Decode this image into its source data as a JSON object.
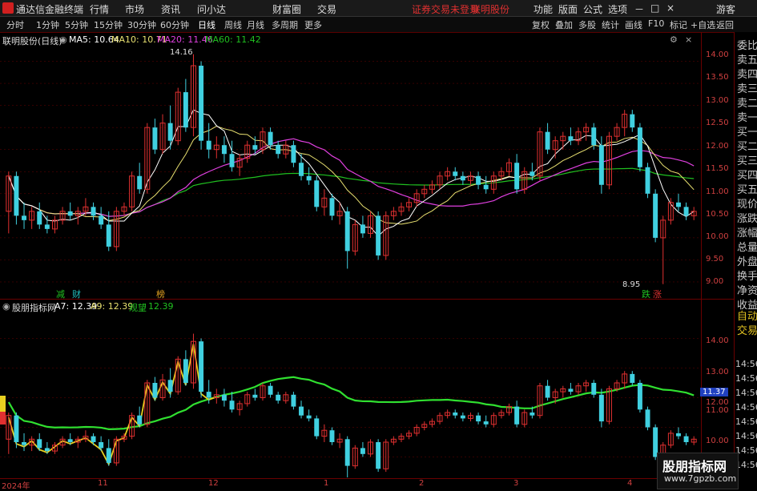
{
  "app": {
    "title": "通达信金融终端",
    "menu": [
      "行情",
      "市场",
      "资讯",
      "问小达",
      "财富圈",
      "交易"
    ],
    "notice": "证券交易未登录",
    "stock_tab": "联明股份",
    "right_menu": [
      "功能",
      "版面",
      "公式",
      "选项"
    ],
    "guest": "游客",
    "window_controls": [
      "－",
      "□",
      "×"
    ]
  },
  "toolbar": {
    "timeframes": [
      "分时",
      "1分钟",
      "5分钟",
      "15分钟",
      "30分钟",
      "60分钟",
      "日线",
      "周线",
      "月线",
      "多周期",
      "更多"
    ],
    "active": "日线",
    "right_buttons": [
      "复权",
      "叠加",
      "多股",
      "统计",
      "画线",
      "F10",
      "标记",
      "+自选",
      "返回"
    ]
  },
  "main_panel": {
    "stock_title": "联明股份(日线)",
    "ma": [
      {
        "label": "MA5: 10.64",
        "color": "#ffffff"
      },
      {
        "label": "MA10: 10.71",
        "color": "#e8e070"
      },
      {
        "label": "MA20: 11.46",
        "color": "#e040e0"
      },
      {
        "label": "MA60: 11.42",
        "color": "#20c020"
      }
    ],
    "high_label": "14.16",
    "low_label": "8.95",
    "y_ticks": [
      "14.00",
      "13.50",
      "13.00",
      "12.50",
      "12.00",
      "11.50",
      "11.00",
      "10.50",
      "10.00",
      "9.50",
      "9.00"
    ],
    "markers": [
      {
        "text": "减",
        "color": "#20c020"
      },
      {
        "text": "财",
        "color": "#20c0c0"
      },
      {
        "text": "榜",
        "color": "#e0a020"
      },
      {
        "text": "跌",
        "color": "#20c020"
      },
      {
        "text": "涨",
        "color": "#e03030"
      }
    ]
  },
  "sub_panel": {
    "indicator_name": "股朋指标网",
    "params": [
      {
        "label": "A7: 12.39",
        "color": "#ffffff"
      },
      {
        "label": "A9: 12.39",
        "color": "#e8e070"
      },
      {
        "label": "观望",
        "color": "#20c020"
      },
      {
        "label": "12.39",
        "color": "#20c020"
      }
    ],
    "y_ticks": [
      "14.00",
      "13.00",
      "12.00",
      "11.00",
      "10.00"
    ],
    "current_price": "11.37"
  },
  "x_axis": [
    "2024年",
    "11",
    "12",
    "1",
    "2",
    "3",
    "4"
  ],
  "right_panel": {
    "labels": [
      "委比",
      "卖五",
      "卖四",
      "卖三",
      "卖二",
      "卖一",
      "买一",
      "买二",
      "买三",
      "买四",
      "买五",
      "现价",
      "涨跌",
      "涨幅",
      "总量",
      "外盘",
      "换手",
      "净资",
      "收益"
    ],
    "lower_labels": [
      "自动",
      "交易"
    ],
    "times": [
      "14:56",
      "14:56",
      "14:56",
      "14:56",
      "14:56",
      "14:56",
      "14:56",
      "14:56"
    ]
  },
  "watermark": {
    "title": "股朋指标网",
    "url": "www.7gpzb.com"
  },
  "colors": {
    "up": "#e03030",
    "down": "#40d0e0",
    "axis": "#d04040",
    "grid": "#6a0000"
  },
  "chart_data": {
    "type": "candlestick",
    "ylim": [
      8.8,
      14.3
    ],
    "candles": [
      [
        10.6,
        11.5,
        10.1,
        11.4
      ],
      [
        11.4,
        11.5,
        10.3,
        10.5
      ],
      [
        10.5,
        10.8,
        10.2,
        10.4
      ],
      [
        10.4,
        10.7,
        10.2,
        10.6
      ],
      [
        10.6,
        10.8,
        10.2,
        10.3
      ],
      [
        10.3,
        10.5,
        10.1,
        10.2
      ],
      [
        10.2,
        10.5,
        10.1,
        10.4
      ],
      [
        10.4,
        10.7,
        10.3,
        10.6
      ],
      [
        10.6,
        10.8,
        10.4,
        10.5
      ],
      [
        10.5,
        10.7,
        10.3,
        10.6
      ],
      [
        10.6,
        10.9,
        10.5,
        10.7
      ],
      [
        10.7,
        10.8,
        10.4,
        10.5
      ],
      [
        10.5,
        10.7,
        10.2,
        10.3
      ],
      [
        10.3,
        10.6,
        9.7,
        9.8
      ],
      [
        9.8,
        10.7,
        9.7,
        10.6
      ],
      [
        10.6,
        10.8,
        10.5,
        10.7
      ],
      [
        10.7,
        11.5,
        10.6,
        11.4
      ],
      [
        11.4,
        11.7,
        11.0,
        11.1
      ],
      [
        11.1,
        12.6,
        11.0,
        12.5
      ],
      [
        12.5,
        12.7,
        11.9,
        12.0
      ],
      [
        12.0,
        12.8,
        11.9,
        12.6
      ],
      [
        12.6,
        13.0,
        12.0,
        12.2
      ],
      [
        12.2,
        13.4,
        12.1,
        13.3
      ],
      [
        13.3,
        13.6,
        12.4,
        12.5
      ],
      [
        12.5,
        14.16,
        12.3,
        13.9
      ],
      [
        13.9,
        14.0,
        12.0,
        12.2
      ],
      [
        12.2,
        12.6,
        11.8,
        12.0
      ],
      [
        12.0,
        12.3,
        11.8,
        12.1
      ],
      [
        12.1,
        12.3,
        11.7,
        11.9
      ],
      [
        11.9,
        12.2,
        11.5,
        11.6
      ],
      [
        11.6,
        11.9,
        11.4,
        11.8
      ],
      [
        11.8,
        12.2,
        11.7,
        12.1
      ],
      [
        12.1,
        12.3,
        11.9,
        12.0
      ],
      [
        12.0,
        12.5,
        11.9,
        12.4
      ],
      [
        12.4,
        12.5,
        12.0,
        12.1
      ],
      [
        12.1,
        12.2,
        11.8,
        11.9
      ],
      [
        11.9,
        12.2,
        11.8,
        12.1
      ],
      [
        12.1,
        12.2,
        11.6,
        11.7
      ],
      [
        11.7,
        11.9,
        11.3,
        11.4
      ],
      [
        11.4,
        11.6,
        11.2,
        11.3
      ],
      [
        11.3,
        11.4,
        10.6,
        10.7
      ],
      [
        10.7,
        11.1,
        10.5,
        10.9
      ],
      [
        10.9,
        11.0,
        10.4,
        10.5
      ],
      [
        10.5,
        10.8,
        10.3,
        10.6
      ],
      [
        10.6,
        10.7,
        9.3,
        9.7
      ],
      [
        9.7,
        10.4,
        9.6,
        10.3
      ],
      [
        10.3,
        10.5,
        10.0,
        10.1
      ],
      [
        10.1,
        10.6,
        10.0,
        10.5
      ],
      [
        10.5,
        10.6,
        9.5,
        9.6
      ],
      [
        9.6,
        10.6,
        9.5,
        10.5
      ],
      [
        10.5,
        10.7,
        10.4,
        10.6
      ],
      [
        10.6,
        10.8,
        10.5,
        10.7
      ],
      [
        10.7,
        10.9,
        10.6,
        10.8
      ],
      [
        10.8,
        11.1,
        10.7,
        11.0
      ],
      [
        11.0,
        11.2,
        10.9,
        11.1
      ],
      [
        11.1,
        11.3,
        11.0,
        11.2
      ],
      [
        11.2,
        11.5,
        11.1,
        11.4
      ],
      [
        11.4,
        11.6,
        11.3,
        11.5
      ],
      [
        11.5,
        11.6,
        11.3,
        11.4
      ],
      [
        11.4,
        11.5,
        11.2,
        11.3
      ],
      [
        11.3,
        11.5,
        11.2,
        11.4
      ],
      [
        11.4,
        11.5,
        11.1,
        11.2
      ],
      [
        11.2,
        11.4,
        11.0,
        11.1
      ],
      [
        11.1,
        11.5,
        11.0,
        11.4
      ],
      [
        11.4,
        11.6,
        11.3,
        11.5
      ],
      [
        11.5,
        11.8,
        11.4,
        11.7
      ],
      [
        11.7,
        11.9,
        11.0,
        11.1
      ],
      [
        11.1,
        11.6,
        11.0,
        11.5
      ],
      [
        11.5,
        11.7,
        11.3,
        11.4
      ],
      [
        11.4,
        12.5,
        11.3,
        12.4
      ],
      [
        12.4,
        12.6,
        11.9,
        12.0
      ],
      [
        12.0,
        12.3,
        11.8,
        12.2
      ],
      [
        12.2,
        12.4,
        12.0,
        12.3
      ],
      [
        12.3,
        12.5,
        12.1,
        12.2
      ],
      [
        12.2,
        12.5,
        12.1,
        12.4
      ],
      [
        12.4,
        12.6,
        12.2,
        12.5
      ],
      [
        12.5,
        12.6,
        12.0,
        12.1
      ],
      [
        12.1,
        12.3,
        11.0,
        11.2
      ],
      [
        11.2,
        12.4,
        11.1,
        12.3
      ],
      [
        12.3,
        12.6,
        12.2,
        12.5
      ],
      [
        12.5,
        12.9,
        12.3,
        12.8
      ],
      [
        12.8,
        12.9,
        12.4,
        12.5
      ],
      [
        12.5,
        12.6,
        11.5,
        11.6
      ],
      [
        11.6,
        11.7,
        10.9,
        11.0
      ],
      [
        11.0,
        11.1,
        9.9,
        10.0
      ],
      [
        10.0,
        10.5,
        8.95,
        10.4
      ],
      [
        10.4,
        10.9,
        10.3,
        10.8
      ],
      [
        10.8,
        11.0,
        10.6,
        10.7
      ],
      [
        10.7,
        10.8,
        10.4,
        10.5
      ],
      [
        10.5,
        10.7,
        10.4,
        10.6
      ]
    ]
  }
}
